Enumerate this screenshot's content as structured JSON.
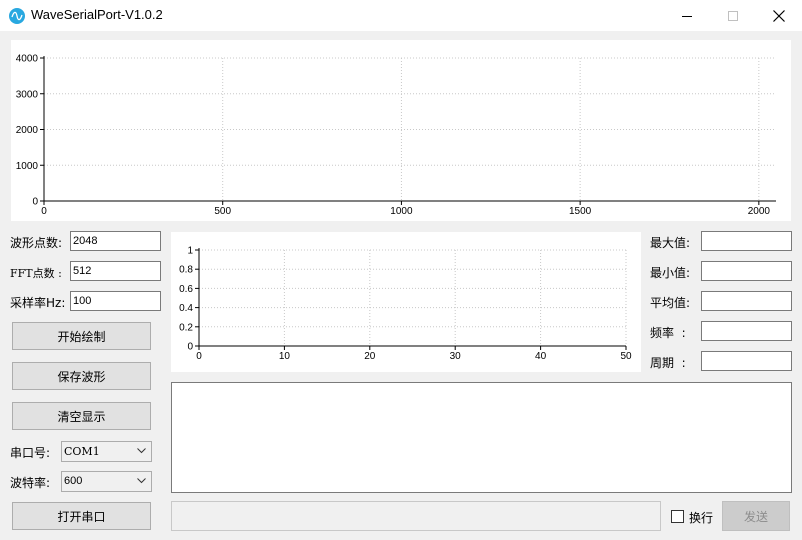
{
  "window": {
    "title": "WaveSerialPort-V1.0.2"
  },
  "wave_chart": {
    "x_ticks": [
      "0",
      "500",
      "1000",
      "1500",
      "2000"
    ],
    "y_ticks": [
      "0",
      "1000",
      "2000",
      "3000",
      "4000"
    ],
    "xlim": [
      0,
      2048
    ],
    "ylim": [
      0,
      4000
    ]
  },
  "fft_chart": {
    "x_ticks": [
      "0",
      "10",
      "20",
      "30",
      "40",
      "50"
    ],
    "y_ticks": [
      "0",
      "0.2",
      "0.4",
      "0.6",
      "0.8",
      "1"
    ],
    "xlim": [
      0,
      50
    ],
    "ylim": [
      0,
      1
    ]
  },
  "settings": {
    "wave_points_label": "波形点数:",
    "wave_points_value": "2048",
    "fft_points_label": "FFT点数 :",
    "fft_points_value": "512",
    "sample_rate_label": "采样率Hz:",
    "sample_rate_value": "100"
  },
  "buttons": {
    "start_draw": "开始绘制",
    "save_wave": "保存波形",
    "clear_display": "清空显示",
    "open_port": "打开串口",
    "send": "发送"
  },
  "serial": {
    "port_label": "串口号:",
    "port_value": "COM1",
    "baud_label": "波特率:",
    "baud_value": "600"
  },
  "stats": {
    "max_label": "最大值:",
    "min_label": "最小值:",
    "avg_label": "平均值:",
    "freq_label": "频率  :",
    "period_label": "周期  :",
    "max_value": "",
    "min_value": "",
    "avg_value": "",
    "freq_value": "",
    "period_value": ""
  },
  "send_area": {
    "newline_label": "换行",
    "newline_checked": false,
    "send_value": ""
  }
}
